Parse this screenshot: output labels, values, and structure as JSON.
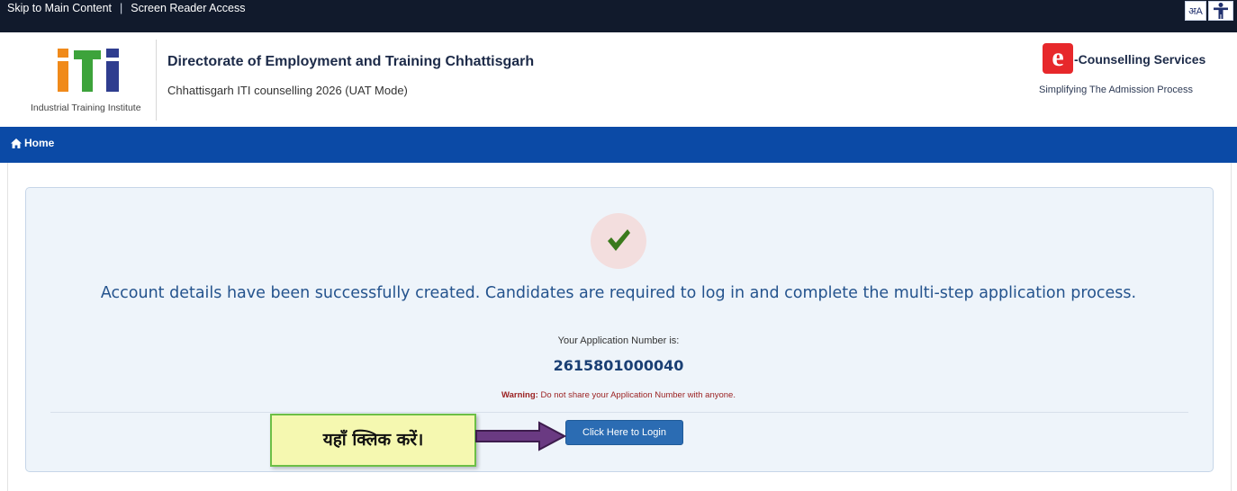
{
  "topbar": {
    "skip_link": "Skip to Main Content",
    "separator": "|",
    "screen_reader": "Screen Reader Access",
    "lang_toggle": "अA"
  },
  "header": {
    "logo_caption": "Industrial Training Institute",
    "title": "Directorate of Employment and Training Chhattisgarh",
    "subtitle": "Chhattisgarh ITI counselling 2026 (UAT Mode)",
    "brand_badge": "e",
    "brand_name": "-Counselling Services",
    "brand_tagline": "Simplifying The Admission Process"
  },
  "nav": {
    "home": "Home"
  },
  "main": {
    "success_message": "Account details have been successfully created. Candidates are required to log in and complete the multi-step application process.",
    "app_number_label": "Your Application Number is:",
    "app_number": "2615801000040",
    "warning_label": "Warning:",
    "warning_text": "Do not share your Application Number  with anyone.",
    "login_button": "Click Here to Login"
  },
  "annotation": {
    "callout_text": "यहाँ क्लिक करें।"
  },
  "colors": {
    "topbar": "#111a2c",
    "navbar": "#0b4aa6",
    "check": "#3a7a1c",
    "button": "#2b6cb3",
    "callout_bg": "#f5f8b0",
    "arrow": "#5a2a6e"
  }
}
